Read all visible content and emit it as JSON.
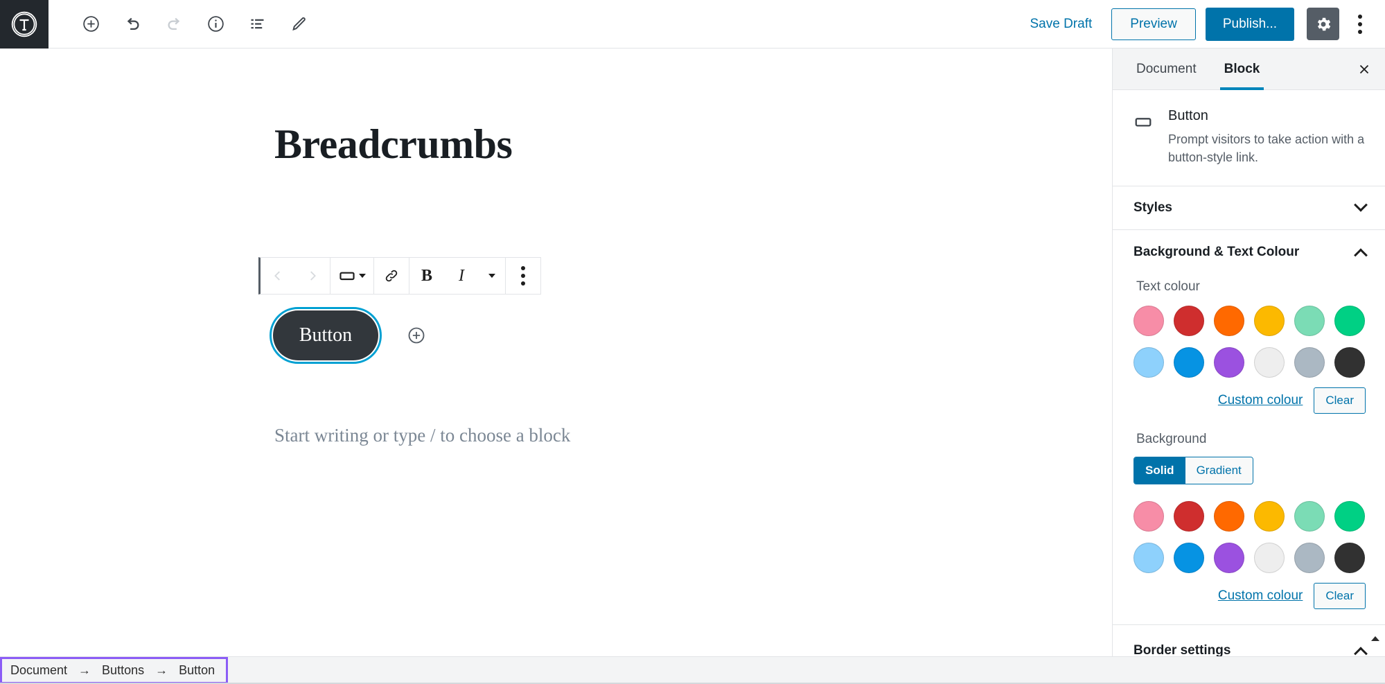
{
  "topbar": {
    "logo_icon": "wordpress-logo-icon",
    "tools": [
      {
        "name": "add-block-icon",
        "label": "Add block",
        "disabled": false
      },
      {
        "name": "undo-icon",
        "label": "Undo",
        "disabled": false
      },
      {
        "name": "redo-icon",
        "label": "Redo",
        "disabled": true
      },
      {
        "name": "info-icon",
        "label": "Content structure",
        "disabled": false
      },
      {
        "name": "list-view-icon",
        "label": "Block navigation",
        "disabled": false
      },
      {
        "name": "pencil-icon",
        "label": "Edit",
        "disabled": false
      }
    ],
    "save_draft_label": "Save Draft",
    "preview_label": "Preview",
    "publish_label": "Publish...",
    "settings_icon": "gear-icon",
    "more_icon": "kebab-menu-icon",
    "accent_blue": "#0073aa",
    "gear_active_bg": "#555d66"
  },
  "canvas": {
    "post_title": "Breadcrumbs",
    "button_block_text": "Button",
    "button_block_bg": "#32373c",
    "button_block_outline": "#00a0d2",
    "appender_icon": "add-block-circle-icon",
    "placeholder": "Start writing or type / to choose a block"
  },
  "block_toolbar": {
    "items": [
      {
        "name": "move-left-icon",
        "label": "Move left",
        "disabled": true
      },
      {
        "name": "move-right-icon",
        "label": "Move right",
        "disabled": true
      },
      {
        "name": "button-block-icon",
        "label": "Change block type",
        "disabled": false
      },
      {
        "name": "link-icon",
        "label": "Link",
        "disabled": false
      },
      {
        "name": "bold-icon",
        "label": "B",
        "disabled": false
      },
      {
        "name": "italic-icon",
        "label": "I",
        "disabled": false
      },
      {
        "name": "more-formatting-icon",
        "label": "More rich text controls",
        "disabled": false
      },
      {
        "name": "block-options-icon",
        "label": "More options",
        "disabled": false
      }
    ]
  },
  "sidebar": {
    "tabs": [
      {
        "label": "Document",
        "active": false
      },
      {
        "label": "Block",
        "active": true
      }
    ],
    "close_icon": "close-icon",
    "block_card": {
      "icon": "button-block-icon",
      "title": "Button",
      "description": "Prompt visitors to take action with a button-style link."
    },
    "panels": [
      {
        "title": "Styles",
        "expanded": false
      },
      {
        "title": "Background & Text Colour",
        "expanded": true
      },
      {
        "title": "Border settings",
        "expanded": true
      }
    ],
    "text_colour": {
      "label": "Text colour",
      "swatches": [
        {
          "name": "pale-pink",
          "hex": "#f78da7"
        },
        {
          "name": "vivid-red",
          "hex": "#cf2e2e"
        },
        {
          "name": "luminous-vivid-orange",
          "hex": "#ff6900"
        },
        {
          "name": "luminous-vivid-amber",
          "hex": "#fcb900"
        },
        {
          "name": "light-green-cyan",
          "hex": "#7bdcb5"
        },
        {
          "name": "vivid-green-cyan",
          "hex": "#00d084"
        },
        {
          "name": "pale-cyan-blue",
          "hex": "#8ed1fc"
        },
        {
          "name": "vivid-cyan-blue",
          "hex": "#0693e3"
        },
        {
          "name": "vivid-purple",
          "hex": "#9b51e0"
        },
        {
          "name": "very-light-gray",
          "hex": "#eeeeee"
        },
        {
          "name": "cyan-bluish-gray",
          "hex": "#abb8c3"
        },
        {
          "name": "very-dark-gray",
          "hex": "#313131"
        }
      ],
      "custom_label": "Custom colour",
      "clear_label": "Clear"
    },
    "background": {
      "label": "Background",
      "segments": [
        {
          "label": "Solid",
          "active": true
        },
        {
          "label": "Gradient",
          "active": false
        }
      ],
      "swatches": [
        {
          "name": "pale-pink",
          "hex": "#f78da7"
        },
        {
          "name": "vivid-red",
          "hex": "#cf2e2e"
        },
        {
          "name": "luminous-vivid-orange",
          "hex": "#ff6900"
        },
        {
          "name": "luminous-vivid-amber",
          "hex": "#fcb900"
        },
        {
          "name": "light-green-cyan",
          "hex": "#7bdcb5"
        },
        {
          "name": "vivid-green-cyan",
          "hex": "#00d084"
        },
        {
          "name": "pale-cyan-blue",
          "hex": "#8ed1fc"
        },
        {
          "name": "vivid-cyan-blue",
          "hex": "#0693e3"
        },
        {
          "name": "vivid-purple",
          "hex": "#9b51e0"
        },
        {
          "name": "very-light-gray",
          "hex": "#eeeeee"
        },
        {
          "name": "cyan-bluish-gray",
          "hex": "#abb8c3"
        },
        {
          "name": "very-dark-gray",
          "hex": "#313131"
        }
      ],
      "custom_label": "Custom colour",
      "clear_label": "Clear"
    }
  },
  "breadcrumb": {
    "highlight_colour": "#8b5cf6",
    "separator": "→",
    "items": [
      {
        "label": "Document"
      },
      {
        "label": "Buttons"
      },
      {
        "label": "Button"
      }
    ]
  }
}
